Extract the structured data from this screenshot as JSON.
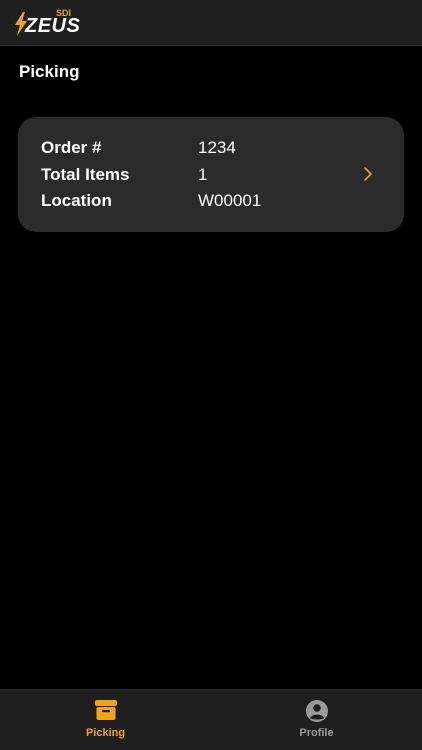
{
  "app": {
    "logo_text": "ZEUS",
    "logo_badge": "SDI",
    "accent_color": "#f2a31b"
  },
  "page": {
    "title": "Picking"
  },
  "order_card": {
    "rows": [
      {
        "label": "Order #",
        "value": "1234"
      },
      {
        "label": "Total Items",
        "value": "1"
      },
      {
        "label": "Location",
        "value": "W00001"
      }
    ],
    "chevron_icon": "chevron-right-icon"
  },
  "tabbar": {
    "tabs": [
      {
        "label": "Picking",
        "icon": "archive-box-icon",
        "active": true
      },
      {
        "label": "Profile",
        "icon": "user-circle-icon",
        "active": false
      }
    ]
  }
}
